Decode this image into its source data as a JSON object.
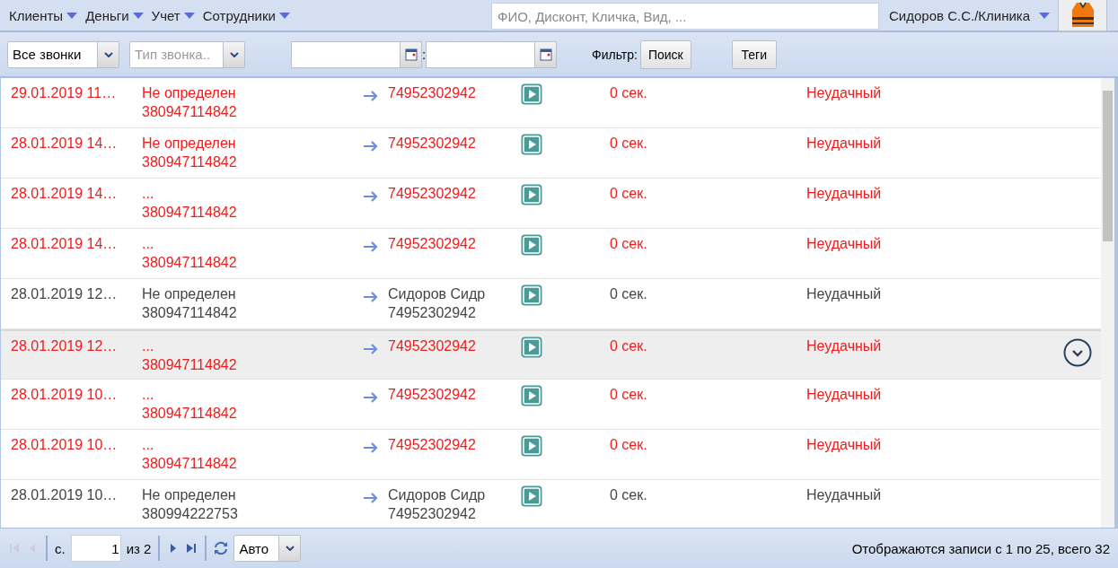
{
  "menu": [
    {
      "label": "Клиенты"
    },
    {
      "label": "Деньги"
    },
    {
      "label": "Учет"
    },
    {
      "label": "Сотрудники"
    }
  ],
  "search": {
    "placeholder": "ФИО, Дисконт, Кличка, Вид, ..."
  },
  "user": {
    "label": "Сидоров С.С./Клиника"
  },
  "toolbar": {
    "call_filter": {
      "value": "Все звонки"
    },
    "call_type": {
      "placeholder": "Тип звонка.."
    },
    "date_separator": ":",
    "filter_label": "Фильтр:",
    "search_button": "Поиск",
    "tags_button": "Теги"
  },
  "rows": [
    {
      "date": "29.01.2019 11…",
      "caller": "Не определен",
      "caller_number": "380947114842",
      "callee": "",
      "callee_number": "74952302942",
      "duration": "0 сек.",
      "status": "Неудачный",
      "missed": true,
      "selected": false
    },
    {
      "date": "28.01.2019 14…",
      "caller": "Не определен",
      "caller_number": "380947114842",
      "callee": "",
      "callee_number": "74952302942",
      "duration": "0 сек.",
      "status": "Неудачный",
      "missed": true,
      "selected": false
    },
    {
      "date": "28.01.2019 14…",
      "caller": "...",
      "caller_number": "380947114842",
      "callee": "",
      "callee_number": "74952302942",
      "duration": "0 сек.",
      "status": "Неудачный",
      "missed": true,
      "selected": false
    },
    {
      "date": "28.01.2019 14…",
      "caller": "...",
      "caller_number": "380947114842",
      "callee": "",
      "callee_number": "74952302942",
      "duration": "0 сек.",
      "status": "Неудачный",
      "missed": true,
      "selected": false
    },
    {
      "date": "28.01.2019 12…",
      "caller": "Не определен",
      "caller_number": "380947114842",
      "callee": "Сидоров Сидр",
      "callee_number": "74952302942",
      "duration": "0 сек.",
      "status": "Неудачный",
      "missed": false,
      "selected": false
    },
    {
      "date": "28.01.2019 12…",
      "caller": "...",
      "caller_number": "380947114842",
      "callee": "",
      "callee_number": "74952302942",
      "duration": "0 сек.",
      "status": "Неудачный",
      "missed": true,
      "selected": true
    },
    {
      "date": "28.01.2019 10…",
      "caller": "...",
      "caller_number": "380947114842",
      "callee": "",
      "callee_number": "74952302942",
      "duration": "0 сек.",
      "status": "Неудачный",
      "missed": true,
      "selected": false
    },
    {
      "date": "28.01.2019 10…",
      "caller": "...",
      "caller_number": "380947114842",
      "callee": "",
      "callee_number": "74952302942",
      "duration": "0 сек.",
      "status": "Неудачный",
      "missed": true,
      "selected": false
    },
    {
      "date": "28.01.2019 10…",
      "caller": "Не определен",
      "caller_number": "380994222753",
      "callee": "Сидоров Сидр",
      "callee_number": "74952302942",
      "duration": "0 сек.",
      "status": "Неудачный",
      "missed": false,
      "selected": false
    }
  ],
  "pager": {
    "page_label": "с.",
    "page": "1",
    "of": "из 2",
    "page_size": "Авто",
    "summary": "Отображаются записи с 1 по 25, всего 32"
  }
}
